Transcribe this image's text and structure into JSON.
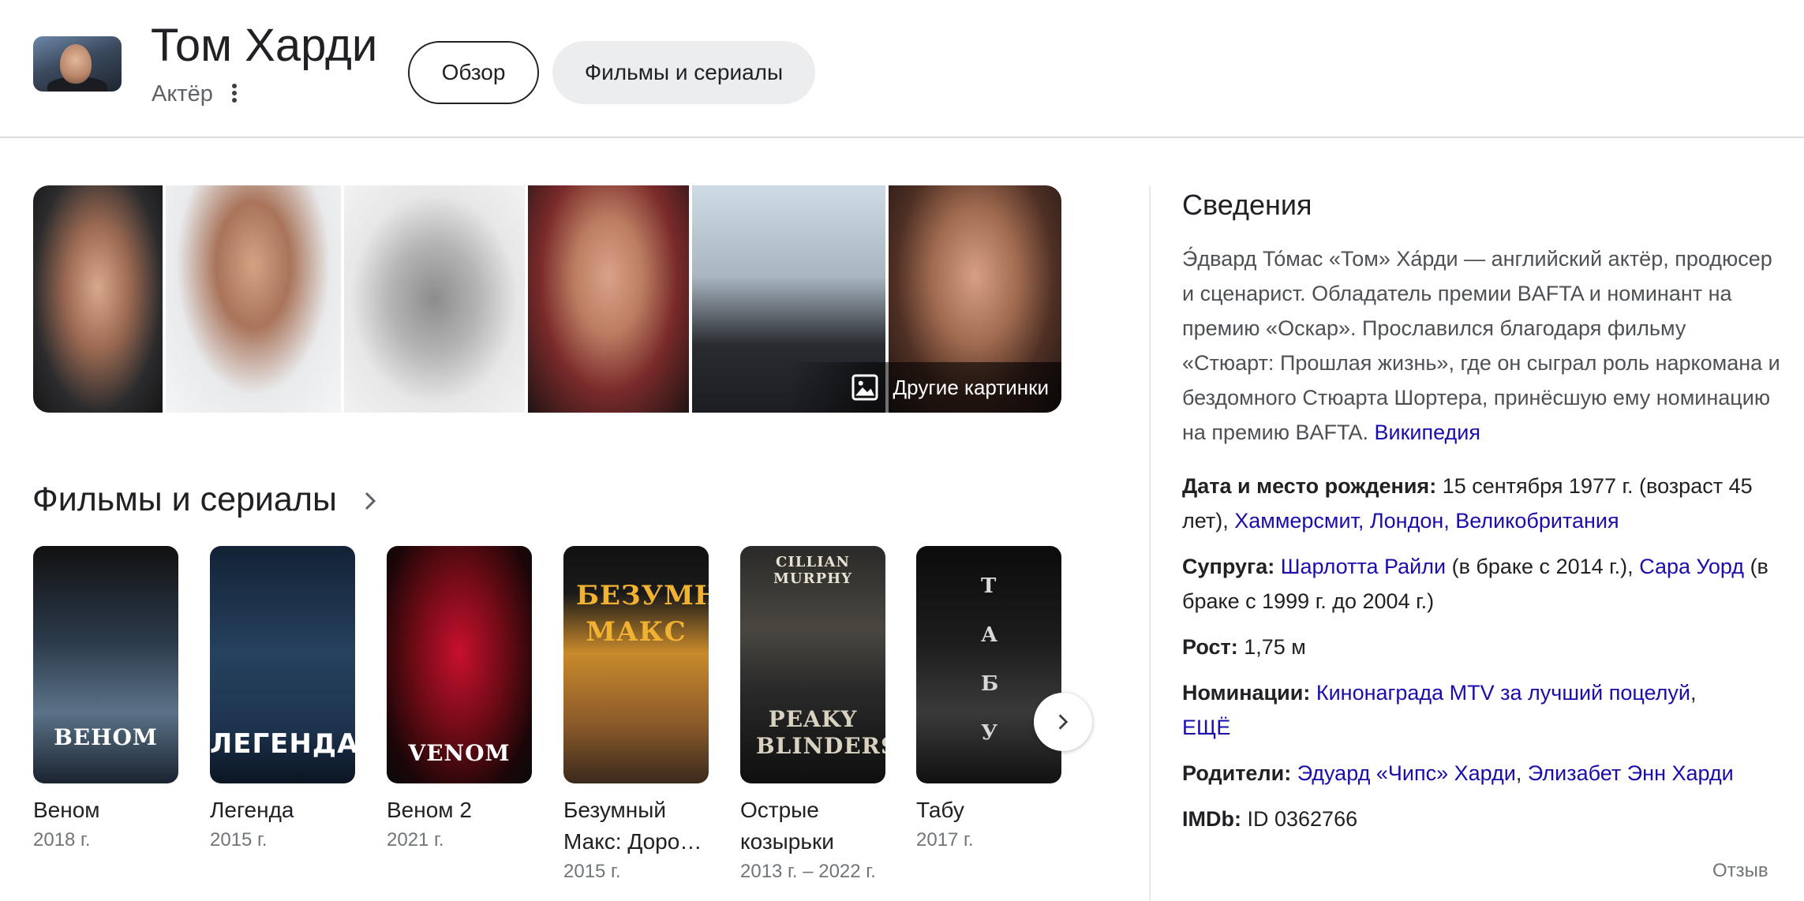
{
  "header": {
    "name": "Том Харди",
    "subtitle": "Актёр",
    "tabs": [
      {
        "label": "Обзор",
        "selected": true
      },
      {
        "label": "Фильмы и сериалы",
        "selected": false
      }
    ]
  },
  "images": {
    "more_label": "Другие картинки"
  },
  "films": {
    "section_title": "Фильмы и сериалы",
    "items": [
      {
        "name": "Веном",
        "year": "2018 г.",
        "poster_text": "ВЕНОМ"
      },
      {
        "name": "Легенда",
        "year": "2015 г.",
        "poster_text": "ЛЕГЕНДА"
      },
      {
        "name": "Веном 2",
        "year": "2021 г.",
        "poster_text": "VENOM"
      },
      {
        "name": "Безумный Макс: Доро…",
        "year": "2015 г.",
        "poster_text": "БЕЗУМНЫЙ МАКС"
      },
      {
        "name": "Острые козырьки",
        "year": "2013 г. – 2022 г.",
        "poster_text": "PEAKY BLINDERS",
        "poster_top": "CILLIAN MURPHY"
      },
      {
        "name": "Табу",
        "year": "2017 г.",
        "poster_text": "Т А Б У"
      }
    ]
  },
  "panel": {
    "title": "Сведения",
    "description": "Э́двард То́мас «Том» Ха́рди — английский актёр, продюсер и сценарист. Обладатель премии BAFTA и номинант на премию «Оскар». Прославился благодаря фильму «Стюарт: Прошлая жизнь», где он сыграл роль наркомана и бездомного Стюарта Шортера, принёсшую ему номинацию на премию BAFTA.",
    "source_link": "Википедия",
    "birth_label": "Дата и место рождения:",
    "birth_text": " 15 сентября 1977 г. (возраст 45 лет), ",
    "birth_link": "Хаммерсмит, Лондон, Великобритания",
    "spouse_label": "Супруга:",
    "spouse1_link": "Шарлотта Райли",
    "spouse1_text": " (в браке с 2014 г.), ",
    "spouse2_link": "Сара Уорд",
    "spouse2_text": " (в браке с 1999 г. до 2004 г.)",
    "height_label": "Рост:",
    "height_value": " 1,75 м",
    "nominations_label": "Номинации:",
    "nominations_link": "Кинонаграда MTV за лучший поцелуй",
    "nominations_sep": ", ",
    "nominations_more": "ЕЩЁ",
    "parents_label": "Родители:",
    "parent1_link": "Эдуард «Чипс» Харди",
    "parents_sep": ", ",
    "parent2_link": "Элизабет Энн Харди",
    "imdb_label": "IMDb:",
    "imdb_value": " ID 0362766",
    "feedback": "Отзыв"
  }
}
